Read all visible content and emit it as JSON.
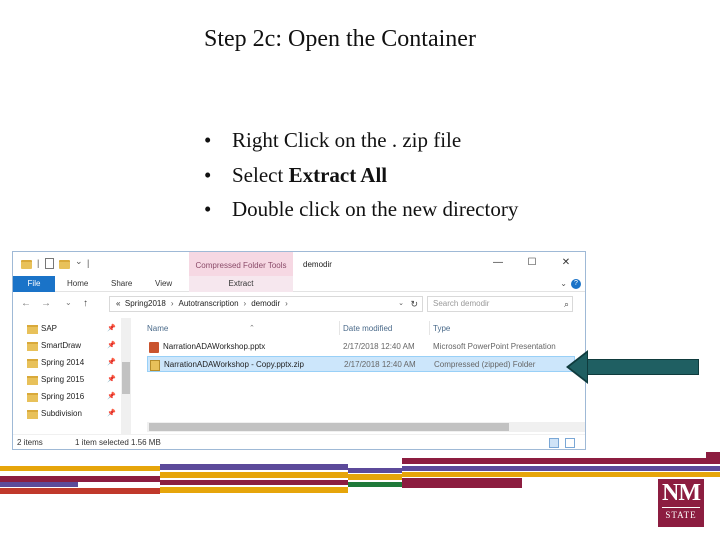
{
  "slide": {
    "title": "Step 2c: Open the Container",
    "bullets": {
      "b1": "Right Click on the . zip file",
      "b2_prefix": "Select ",
      "b2_bold": "Extract All",
      "b3": "Double click on the new directory",
      "marker": "•"
    }
  },
  "explorer": {
    "title": "demodir",
    "context_tab": "Compressed Folder Tools",
    "window_controls": {
      "minimize": "—",
      "maximize": "☐",
      "close": "✕"
    },
    "ribbon": {
      "file": "File",
      "home": "Home",
      "share": "Share",
      "view": "View",
      "extract": "Extract",
      "help": "?",
      "collapse": "⌄"
    },
    "nav_buttons": {
      "back": "←",
      "forward": "→",
      "recent": "⌄",
      "up": "↑"
    },
    "address": {
      "lead": "«",
      "parts": {
        "p1": "Spring2018",
        "p2": "Autotranscription",
        "p3": "demodir"
      },
      "sep": "›",
      "dropdown": "⌄",
      "refresh": "↻"
    },
    "search": {
      "placeholder": "Search demodir",
      "icon": "⌕"
    },
    "sidebar": {
      "items": [
        {
          "label": "SAP"
        },
        {
          "label": "SmartDraw"
        },
        {
          "label": "Spring 2014"
        },
        {
          "label": "Spring 2015"
        },
        {
          "label": "Spring 2016"
        },
        {
          "label": "Subdivision"
        }
      ],
      "pin": "📌"
    },
    "columns": {
      "name": "Name",
      "date": "Date modified",
      "type": "Type",
      "sort_caret": "⌃"
    },
    "files": [
      {
        "name": "NarrationADAWorkshop.pptx",
        "date": "2/17/2018 12:40 AM",
        "type": "Microsoft PowerPoint Presentation",
        "selected": false,
        "icon": "pptx-icon"
      },
      {
        "name": "NarrationADAWorkshop - Copy.pptx.zip",
        "date": "2/17/2018 12:40 AM",
        "type": "Compressed (zipped) Folder",
        "selected": true,
        "icon": "zip-icon"
      }
    ],
    "status": {
      "count": "2 items",
      "selected": "1 item selected",
      "size": "1.56 MB"
    }
  },
  "logo": {
    "name": "NM",
    "sub": "STATE",
    "color": "#8c1d40"
  },
  "colors": {
    "accent": "#1a73c8",
    "arrow": "#1f5f62",
    "crimson": "#8c1d40",
    "gold": "#e6a50a",
    "purple": "#5c4a9a"
  }
}
